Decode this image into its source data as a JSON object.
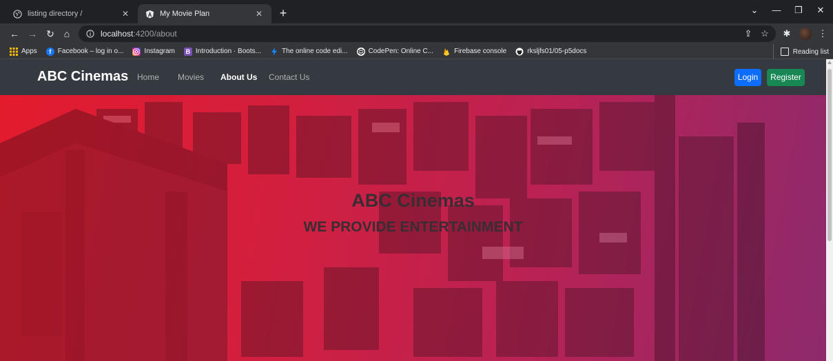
{
  "browser": {
    "tabs": [
      {
        "title": "listing directory /",
        "active": false
      },
      {
        "title": "My Movie Plan",
        "active": true
      }
    ],
    "new_tab_label": "+",
    "address": {
      "host": "localhost",
      "rest": ":4200/about"
    },
    "bookmarks": [
      {
        "label": "Apps",
        "icon": "apps-grid-icon",
        "color": "#fbbc04"
      },
      {
        "label": "Facebook – log in o...",
        "icon": "facebook-icon",
        "color": "#1877f2"
      },
      {
        "label": "Instagram",
        "icon": "instagram-icon",
        "color": "#d6249f"
      },
      {
        "label": "Introduction · Boots...",
        "icon": "bootstrap-icon",
        "color": "#7952b3"
      },
      {
        "label": "The online code edi...",
        "icon": "bolt-icon",
        "color": "#1389fd"
      },
      {
        "label": "CodePen: Online C...",
        "icon": "codepen-icon",
        "color": "#ffffff"
      },
      {
        "label": "Firebase console",
        "icon": "firebase-icon",
        "color": "#ffca28"
      },
      {
        "label": "rksljfs01/05-p5docs",
        "icon": "github-icon",
        "color": "#ffffff"
      }
    ],
    "reading_list_label": "Reading list"
  },
  "page": {
    "brand": "ABC Cinemas",
    "nav": [
      {
        "label": "Home",
        "active": false
      },
      {
        "label": "Movies",
        "active": false
      },
      {
        "label": "About Us",
        "active": true
      },
      {
        "label": "Contact Us",
        "active": false
      }
    ],
    "login_label": "Login",
    "register_label": "Register",
    "hero": {
      "title": "ABC Cinemas",
      "subtitle": "WE PROVIDE ENTERTAINMENT"
    },
    "colors": {
      "navbar": "#343a40",
      "login": "#0d6efd",
      "register": "#198754",
      "hero_start": "#e31b2d",
      "hero_end": "#8d2a6c"
    }
  }
}
